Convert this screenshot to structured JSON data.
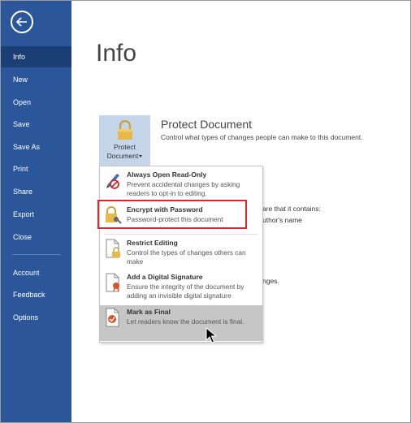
{
  "sidebar": {
    "back_icon": "back-arrow-icon",
    "items": [
      {
        "label": "Info",
        "active": true
      },
      {
        "label": "New"
      },
      {
        "label": "Open"
      },
      {
        "label": "Save"
      },
      {
        "label": "Save As"
      },
      {
        "label": "Print"
      },
      {
        "label": "Share"
      },
      {
        "label": "Export"
      },
      {
        "label": "Close"
      },
      {
        "label": "Account"
      },
      {
        "label": "Feedback"
      },
      {
        "label": "Options"
      }
    ]
  },
  "main": {
    "title": "Info",
    "protect_button": {
      "line1": "Protect",
      "line2": "Document"
    },
    "section_title": "Protect Document",
    "section_desc": "Control what types of changes people can make to this document.",
    "bg_fragments": [
      "are that it contains:",
      "uthor's name",
      "nges."
    ]
  },
  "menu": {
    "items": [
      {
        "title": "Always Open Read-Only",
        "desc": "Prevent accidental changes by asking readers to opt-in to editing."
      },
      {
        "title": "Encrypt with Password",
        "desc": "Password-protect this document"
      },
      {
        "title": "Restrict Editing",
        "desc": "Control the types of changes others can make"
      },
      {
        "title": "Add a Digital Signature",
        "desc": "Ensure the integrity of the document by adding an invisible digital signature"
      },
      {
        "title": "Mark as Final",
        "desc": "Let readers know the document is final."
      }
    ]
  },
  "colors": {
    "sidebar_bg": "#2b579a",
    "sidebar_active": "#1b3f74",
    "highlight_border": "#d62b2b",
    "hover_bg": "#c6c6c6"
  }
}
